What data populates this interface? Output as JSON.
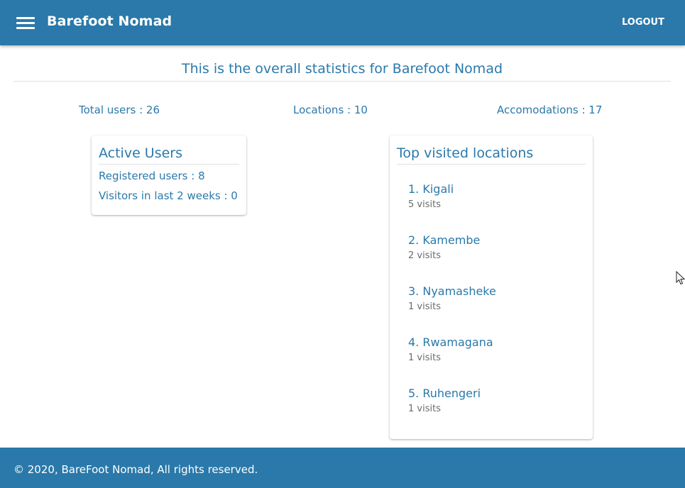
{
  "appbar": {
    "title": "Barefoot Nomad",
    "logout_label": "LOGOUT"
  },
  "heading": "This is the overall statistics for Barefoot Nomad",
  "stats": {
    "total_users": "Total users : 26",
    "locations": "Locations : 10",
    "accomodations": "Accomodations : 17"
  },
  "active_users": {
    "title": "Active Users",
    "registered": "Registered users : 8",
    "visitors": "Visitors in last 2 weeks : 0"
  },
  "top_locations": {
    "title": "Top visited locations",
    "items": [
      {
        "name": "1. Kigali",
        "visits": "5 visits"
      },
      {
        "name": "2. Kamembe",
        "visits": "2 visits"
      },
      {
        "name": "3. Nyamasheke",
        "visits": "1 visits"
      },
      {
        "name": "4. Rwamagana",
        "visits": "1 visits"
      },
      {
        "name": "5. Ruhengeri",
        "visits": "1 visits"
      }
    ]
  },
  "footer": {
    "copyright": "© 2020, BareFoot Nomad, All rights reserved."
  },
  "colors": {
    "primary": "#2a79aa",
    "muted_text": "#6b6b6b"
  },
  "icons": {
    "menu": "hamburger-menu-icon",
    "cursor": "mouse-pointer-icon"
  }
}
